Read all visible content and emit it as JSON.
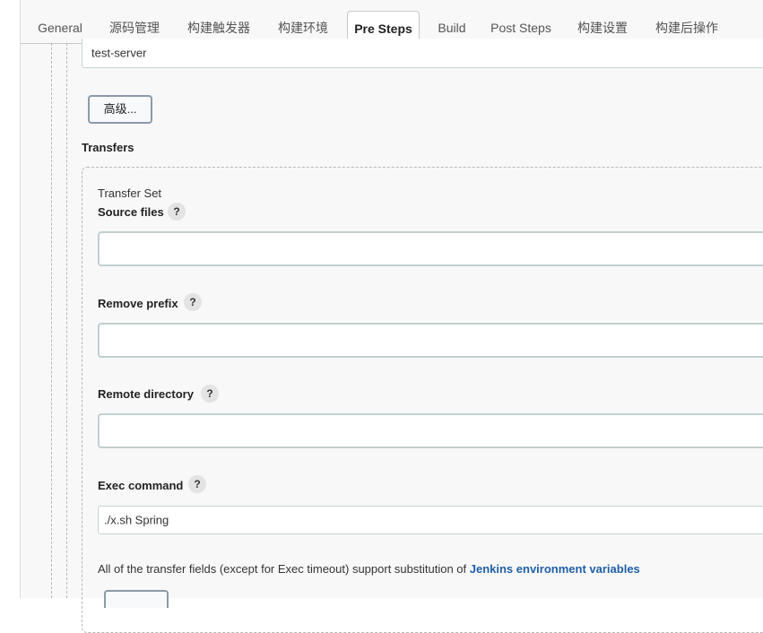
{
  "tabs": [
    {
      "label": "General"
    },
    {
      "label": "源码管理"
    },
    {
      "label": "构建触发器"
    },
    {
      "label": "构建环境"
    },
    {
      "label": "Pre Steps"
    },
    {
      "label": "Build"
    },
    {
      "label": "Post Steps"
    },
    {
      "label": "构建设置"
    },
    {
      "label": "构建后操作"
    }
  ],
  "active_tab": "Pre Steps",
  "server": {
    "value": "test-server"
  },
  "advanced_button": {
    "label": "高级..."
  },
  "transfers": {
    "heading": "Transfers"
  },
  "transfer_set": {
    "title": "Transfer Set",
    "help_glyph": "?",
    "source_files": {
      "label": "Source files",
      "value": ""
    },
    "remove_prefix": {
      "label": "Remove prefix",
      "value": ""
    },
    "remote_directory": {
      "label": "Remote directory",
      "value": ""
    },
    "exec_command": {
      "label": "Exec command",
      "value": "./x.sh Spring"
    },
    "info_text": "All of the transfer fields (except for Exec timeout) support substitution of ",
    "info_link": "Jenkins environment variables"
  },
  "colors": {
    "link": "#1f5fa8",
    "background": "#f8f8f8",
    "input_border": "#c2cfcf"
  }
}
